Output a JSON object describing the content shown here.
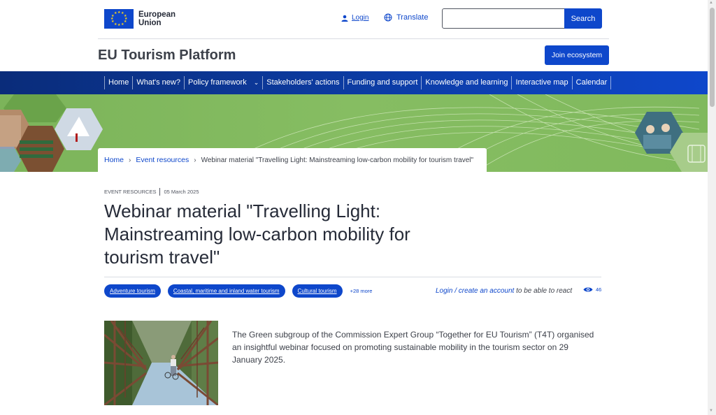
{
  "header": {
    "logo_line1": "European",
    "logo_line2": "Union",
    "login_label": "Login",
    "translate_label": "Translate",
    "search_placeholder": "",
    "search_button": "Search"
  },
  "site": {
    "title": "EU Tourism Platform",
    "join_button": "Join ecosystem"
  },
  "nav": {
    "items": [
      "Home",
      "What's new?",
      "Policy framework",
      "Stakeholders' actions",
      "Funding and support",
      "Knowledge and learning",
      "Interactive map",
      "Calendar"
    ]
  },
  "breadcrumb": {
    "home": "Home",
    "event_resources": "Event resources",
    "current": "Webinar material \"Travelling Light: Mainstreaming low-carbon mobility for tourism travel\""
  },
  "article": {
    "category": "EVENT RESOURCES",
    "date": "05 March 2025",
    "title": "Webinar material \"Travelling Light: Mainstreaming low-carbon mobility for tourism travel\"",
    "tags": [
      "Adventure tourism",
      "Coastal, maritime and inland water tourism",
      "Cultural tourism"
    ],
    "more_tags": "+28 more",
    "react_login": "Login / create an account",
    "react_suffix": " to be able to react",
    "views": "46",
    "intro": "The Green subgroup of the Commission Expert Group “Together for EU Tourism” (T4T) organised an insightful webinar focused on promoting sustainable mobility in the tourism sector on 29 January 2025."
  },
  "icons": {
    "login": "user-icon",
    "translate": "globe-icon",
    "views": "eye-icon",
    "nav_dropdown": "chevron-down-icon"
  },
  "colors": {
    "primary": "#0e47cb",
    "banner_green": "#86bd62",
    "text": "#262b38"
  }
}
